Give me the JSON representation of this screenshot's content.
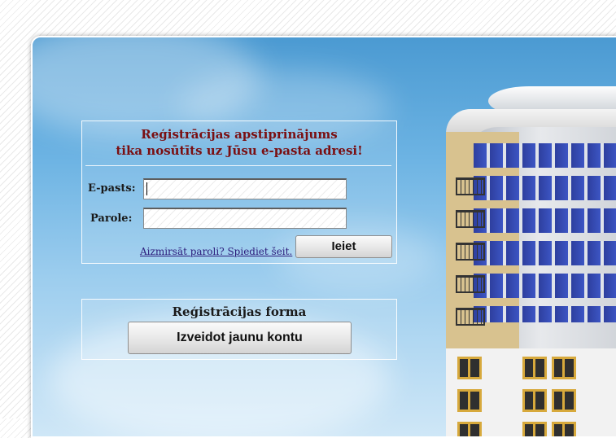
{
  "login": {
    "confirm_line1": "Reģistrācijas apstiprinājums",
    "confirm_line2": "tika nosūtīts uz Jūsu e-pasta adresi!",
    "email_label": "E-pasts:",
    "email_value": "",
    "password_label": "Parole:",
    "password_value": "",
    "forgot_link": "Aizmirsāt paroli? Spiediet šeit.",
    "login_button": "Ieiet"
  },
  "registration": {
    "title": "Reģistrācijas forma",
    "create_button": "Izveidot jaunu kontu"
  },
  "colors": {
    "confirm_text": "#7a0f12",
    "link_text": "#2b1a7a",
    "sky_top": "#4b9ad2",
    "sky_bottom": "#cfe7f7"
  }
}
